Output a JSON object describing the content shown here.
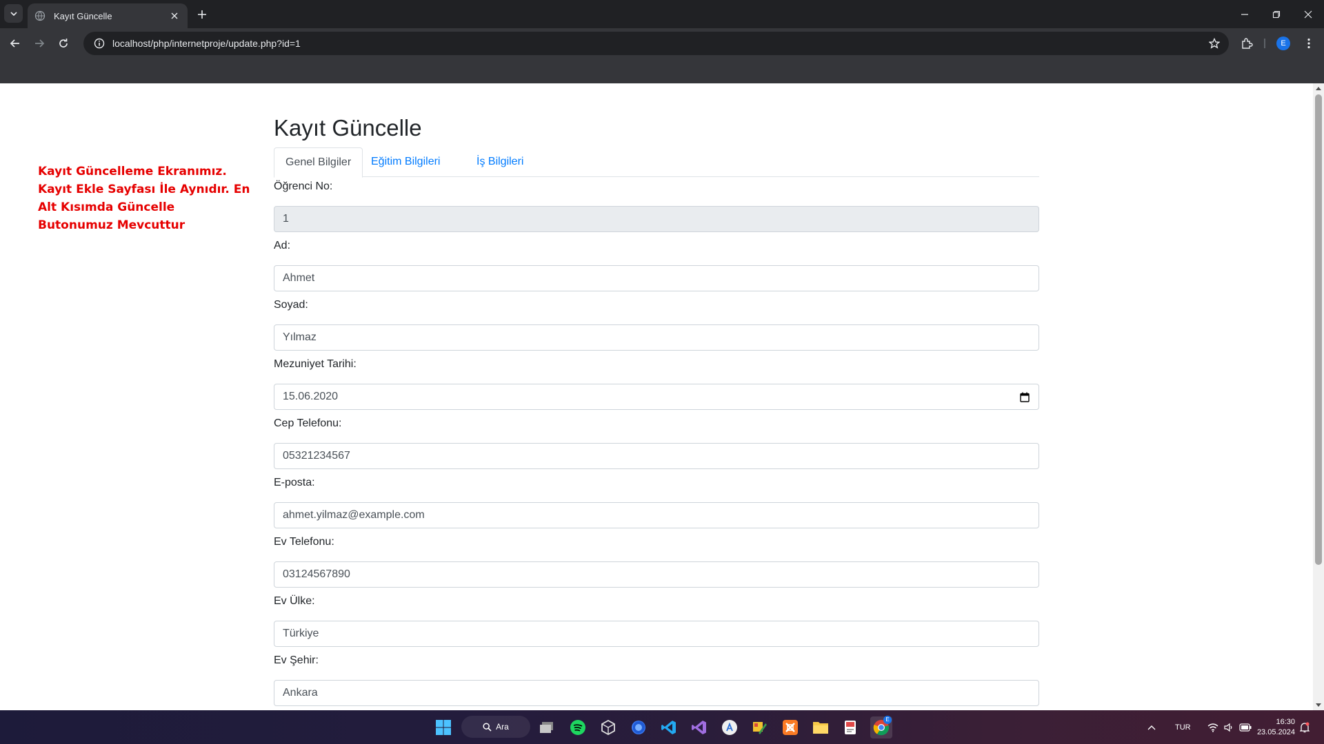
{
  "browser": {
    "tab_title": "Kayıt Güncelle",
    "url": "localhost/php/internetproje/update.php?id=1",
    "profile_initial": "E"
  },
  "note": "Kayıt Güncelleme Ekranımız. Kayıt Ekle Sayfası İle Aynıdır. En Alt Kısımda Güncelle Butonumuz Mevcuttur",
  "page": {
    "title": "Kayıt Güncelle",
    "tabs": [
      {
        "label": "Genel Bilgiler",
        "active": true
      },
      {
        "label": "Eğitim Bilgileri",
        "active": false
      },
      {
        "label": "İş Bilgileri",
        "active": false
      }
    ],
    "fields": [
      {
        "label": "Öğrenci No:",
        "value": "1",
        "readonly": true
      },
      {
        "label": "Ad:",
        "value": "Ahmet"
      },
      {
        "label": "Soyad:",
        "value": "Yılmaz"
      },
      {
        "label": "Mezuniyet Tarihi:",
        "value": "15.06.2020",
        "type": "date"
      },
      {
        "label": "Cep Telefonu:",
        "value": "05321234567"
      },
      {
        "label": "E-posta:",
        "value": "ahmet.yilmaz@example.com"
      },
      {
        "label": "Ev Telefonu:",
        "value": "03124567890"
      },
      {
        "label": "Ev Ülke:",
        "value": "Türkiye"
      },
      {
        "label": "Ev Şehir:",
        "value": "Ankara"
      }
    ]
  },
  "taskbar": {
    "search_label": "Ara",
    "language": "TUR",
    "time": "16:30",
    "date": "23.05.2024",
    "chrome_badge": "E"
  },
  "colors": {
    "note_red": "#e60000",
    "link_blue": "#007bff",
    "chrome_dark": "#202124",
    "chrome_toolbar": "#35363a"
  }
}
